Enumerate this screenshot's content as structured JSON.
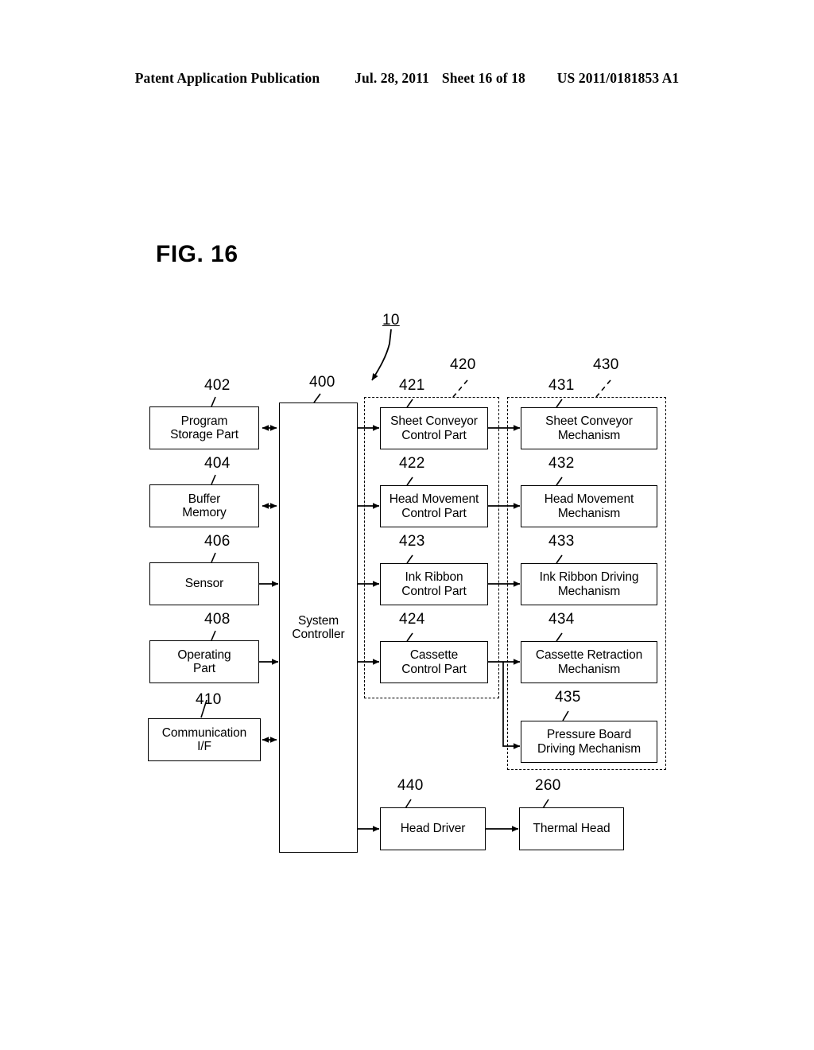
{
  "header": {
    "publication": "Patent Application Publication",
    "date": "Jul. 28, 2011",
    "sheet": "Sheet 16 of 18",
    "number": "US 2011/0181853 A1"
  },
  "figure": {
    "title": "FIG. 16",
    "system_ref": "10"
  },
  "blocks": {
    "program_storage": {
      "ref": "402",
      "label": "Program\nStorage Part"
    },
    "buffer_memory": {
      "ref": "404",
      "label": "Buffer\nMemory"
    },
    "sensor": {
      "ref": "406",
      "label": "Sensor"
    },
    "operating_part": {
      "ref": "408",
      "label": "Operating\nPart"
    },
    "communication_if": {
      "ref": "410",
      "label": "Communication\nI/F"
    },
    "system_controller": {
      "ref": "400",
      "label": "System\nController"
    },
    "sheet_conveyor_control": {
      "ref": "421",
      "label": "Sheet Conveyor\nControl Part"
    },
    "head_movement_control": {
      "ref": "422",
      "label": "Head Movement\nControl Part"
    },
    "ink_ribbon_control": {
      "ref": "423",
      "label": "Ink Ribbon\nControl Part"
    },
    "cassette_control": {
      "ref": "424",
      "label": "Cassette\nControl Part"
    },
    "sheet_conveyor_mechanism": {
      "ref": "431",
      "label": "Sheet Conveyor\nMechanism"
    },
    "head_movement_mechanism": {
      "ref": "432",
      "label": "Head Movement\nMechanism"
    },
    "ink_ribbon_driving_mechanism": {
      "ref": "433",
      "label": "Ink Ribbon Driving\nMechanism"
    },
    "cassette_retraction_mechanism": {
      "ref": "434",
      "label": "Cassette Retraction\nMechanism"
    },
    "pressure_board_driving_mechanism": {
      "ref": "435",
      "label": "Pressure Board\nDriving Mechanism"
    },
    "head_driver": {
      "ref": "440",
      "label": "Head Driver"
    },
    "thermal_head": {
      "ref": "260",
      "label": "Thermal Head"
    }
  },
  "groups": {
    "control_parts": {
      "ref": "420"
    },
    "mechanisms": {
      "ref": "430"
    }
  },
  "colors": {
    "line": "#000000",
    "background": "#ffffff"
  }
}
